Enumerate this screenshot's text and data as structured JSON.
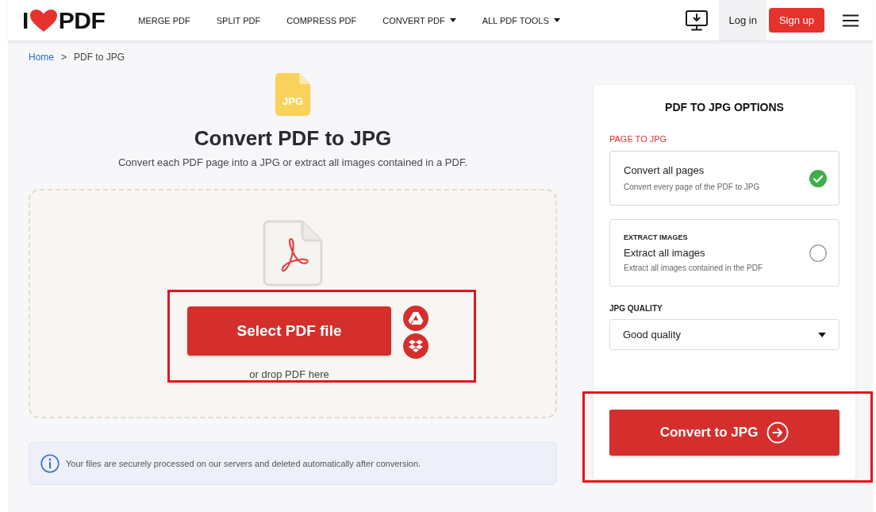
{
  "header": {
    "logo": {
      "prefix": "I",
      "suffix": "PDF"
    },
    "nav": [
      {
        "label": "MERGE PDF",
        "dropdown": false
      },
      {
        "label": "SPLIT PDF",
        "dropdown": false
      },
      {
        "label": "COMPRESS PDF",
        "dropdown": false
      },
      {
        "label": "CONVERT PDF",
        "dropdown": true
      },
      {
        "label": "ALL PDF TOOLS",
        "dropdown": true
      }
    ],
    "actions": [
      {
        "label": "Log in",
        "kind": "link"
      },
      {
        "label": "Sign up",
        "kind": "button"
      }
    ]
  },
  "breadcrumb": [
    {
      "label": "Home",
      "kind": "link"
    },
    {
      "label": ">",
      "kind": "separator"
    },
    {
      "label": "PDF to JPG",
      "kind": "current"
    }
  ],
  "hero": {
    "badge": "JPG",
    "title": "Convert PDF to JPG",
    "subtitle": "Convert each PDF page into a JPG or extract all images contained in a PDF."
  },
  "upload": {
    "button": "Select PDF file",
    "sources": [
      {
        "kind": "drive"
      },
      {
        "kind": "dropbox"
      }
    ],
    "hint": "or drop PDF here"
  },
  "notice": "Your files are securely processed on our servers and deleted automatically after conversion.",
  "options": {
    "title": "PDF TO JPG OPTIONS",
    "section": "PAGE TO JPG",
    "modes": [
      {
        "title": "Convert all pages",
        "description": "Convert every page of the PDF to JPG",
        "selected": true
      },
      {
        "heading": "EXTRACT IMAGES",
        "title": "Extract all images",
        "description": "Extract all images contained in the PDF",
        "selected": false
      }
    ],
    "quality": {
      "label": "JPG QUALITY",
      "value": "Good quality"
    },
    "submit": "Convert to JPG"
  }
}
